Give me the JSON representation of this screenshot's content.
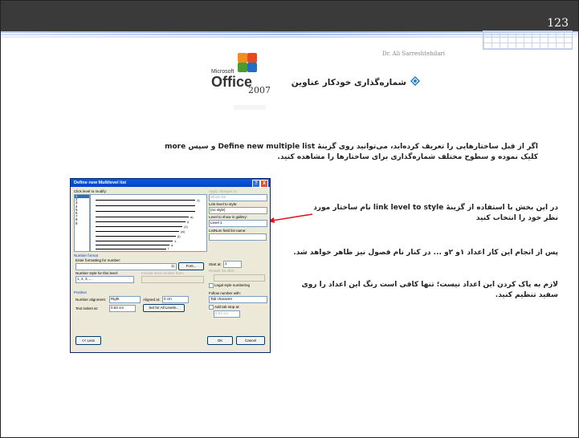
{
  "slide": {
    "page_number": "123",
    "author": "Dr. Ali Sarreshtehdari",
    "logo": {
      "brand": "Microsoft",
      "product": "Office",
      "version": "2007"
    },
    "title": "شماره‌گذاری خودکار عناوین",
    "intro": "اگر از قبل ساختارهایی را تعریف کرده‌اید، می‌توانید روی گزینهٔ Define new multiple list و سپس more کلیک نموده و سطوح مختلف شماره‌گذاری برای ساختارها را مشاهده کنید.",
    "para1": "در این بخش با استفاده از گزینهٔ link level to style نام ساختار مورد نظر خود را انتخاب کنید",
    "para2": "پس از انجام این کار اعداد ۱و ۲و ... در کنار نام فصول نیز ظاهر خواهد شد.",
    "para3": "لازم به پاک کردن این اعداد نیست؛ تنها کافی است رنگ این اعداد را روی سفید تنظیم کنید.",
    "colors": {
      "top_bar": "#3a3a3a",
      "arrow": "#e0191b",
      "dialog_title": "#0a5ae0"
    }
  },
  "dialog": {
    "title": "Define new Multilevel list",
    "help": "?",
    "close": "X",
    "click_level_label": "Click level to modify:",
    "levels": [
      "1",
      "2",
      "3",
      "4",
      "5",
      "6",
      "7",
      "8",
      "9"
    ],
    "preview_labels": [
      "1)",
      "a)",
      "i)",
      "(1)",
      "(a)",
      "(i)",
      "1.",
      "a.",
      "i."
    ],
    "apply_changes_label": "Apply changes to:",
    "apply_changes_value": "Whole list",
    "link_level_label": "Link level to style:",
    "link_level_value": "(no style)",
    "gallery_label": "Level to show in gallery:",
    "gallery_value": "Level 1",
    "listnum_label": "ListNum field list name:",
    "number_format_section": "Number format",
    "enter_format_label": "Enter formatting for number:",
    "enter_format_value": "1)",
    "font_button": "Font...",
    "number_style_label": "Number style for this level:",
    "number_style_value": "1, 2, 3, ...",
    "include_level_label": "Include level number from:",
    "start_at_label": "Start at:",
    "start_at_value": "1",
    "restart_label": "Restart list after:",
    "legal_label": "Legal style numbering",
    "position_section": "Position",
    "number_alignment_label": "Number alignment:",
    "number_alignment_value": "Right",
    "aligned_at_label": "Aligned at:",
    "aligned_at_value": "0 cm",
    "text_indent_label": "Text indent at:",
    "text_indent_value": "0.63 cm",
    "set_all_button": "Set for All Levels...",
    "follow_number_label": "Follow number with:",
    "follow_number_value": "Tab character",
    "add_tab_label": "Add tab stop at:",
    "add_tab_value": "0.63 cm",
    "less_button": "<< Less",
    "ok_button": "OK",
    "cancel_button": "Cancel"
  }
}
